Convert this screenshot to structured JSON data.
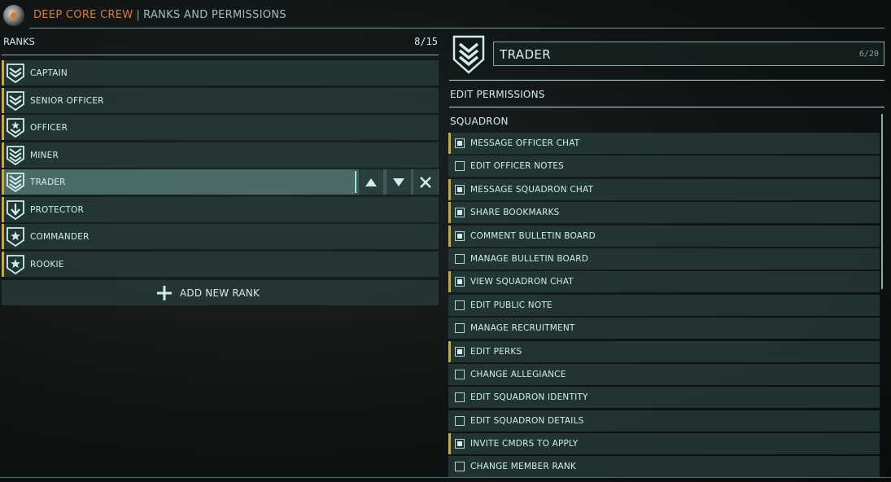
{
  "header": {
    "squadron": "DEEP CORE CREW",
    "separator": "|",
    "page": "RANKS AND PERMISSIONS"
  },
  "ranks": {
    "heading": "RANKS",
    "count": "8/15",
    "items": [
      {
        "label": "CAPTAIN",
        "icon": "chevron-wings-icon"
      },
      {
        "label": "SENIOR OFFICER",
        "icon": "chevron-wings-icon"
      },
      {
        "label": "OFFICER",
        "icon": "star-chevron-icon"
      },
      {
        "label": "MINER",
        "icon": "triple-chevron-icon"
      },
      {
        "label": "TRADER",
        "icon": "triple-chevron-icon"
      },
      {
        "label": "PROTECTOR",
        "icon": "shield-arrow-icon"
      },
      {
        "label": "COMMANDER",
        "icon": "star-shield-icon"
      },
      {
        "label": "ROOKIE",
        "icon": "star-shield-icon"
      }
    ],
    "selected_index": 4,
    "add_label": "ADD NEW RANK"
  },
  "editor": {
    "rank_name": "TRADER",
    "name_count": "6/20",
    "edit_permissions": "EDIT PERMISSIONS",
    "section": "SQUADRON",
    "permissions": [
      {
        "label": "MESSAGE OFFICER CHAT",
        "checked": true
      },
      {
        "label": "EDIT OFFICER NOTES",
        "checked": false
      },
      {
        "label": "MESSAGE SQUADRON CHAT",
        "checked": true
      },
      {
        "label": "SHARE BOOKMARKS",
        "checked": true
      },
      {
        "label": "COMMENT BULLETIN BOARD",
        "checked": true
      },
      {
        "label": "MANAGE BULLETIN BOARD",
        "checked": false
      },
      {
        "label": "VIEW SQUADRON CHAT",
        "checked": true
      },
      {
        "label": "EDIT PUBLIC NOTE",
        "checked": false
      },
      {
        "label": "MANAGE RECRUITMENT",
        "checked": false
      },
      {
        "label": "EDIT PERKS",
        "checked": true
      },
      {
        "label": "CHANGE ALLEGIANCE",
        "checked": false
      },
      {
        "label": "EDIT SQUADRON IDENTITY",
        "checked": false
      },
      {
        "label": "EDIT SQUADRON DETAILS",
        "checked": false
      },
      {
        "label": "INVITE CMDRS TO APPLY",
        "checked": true
      },
      {
        "label": "CHANGE MEMBER RANK",
        "checked": false
      }
    ]
  },
  "colors": {
    "accent_orange": "#e37b22",
    "accent_yellow": "#c8a93a",
    "cyan": "#9fe3dd"
  }
}
